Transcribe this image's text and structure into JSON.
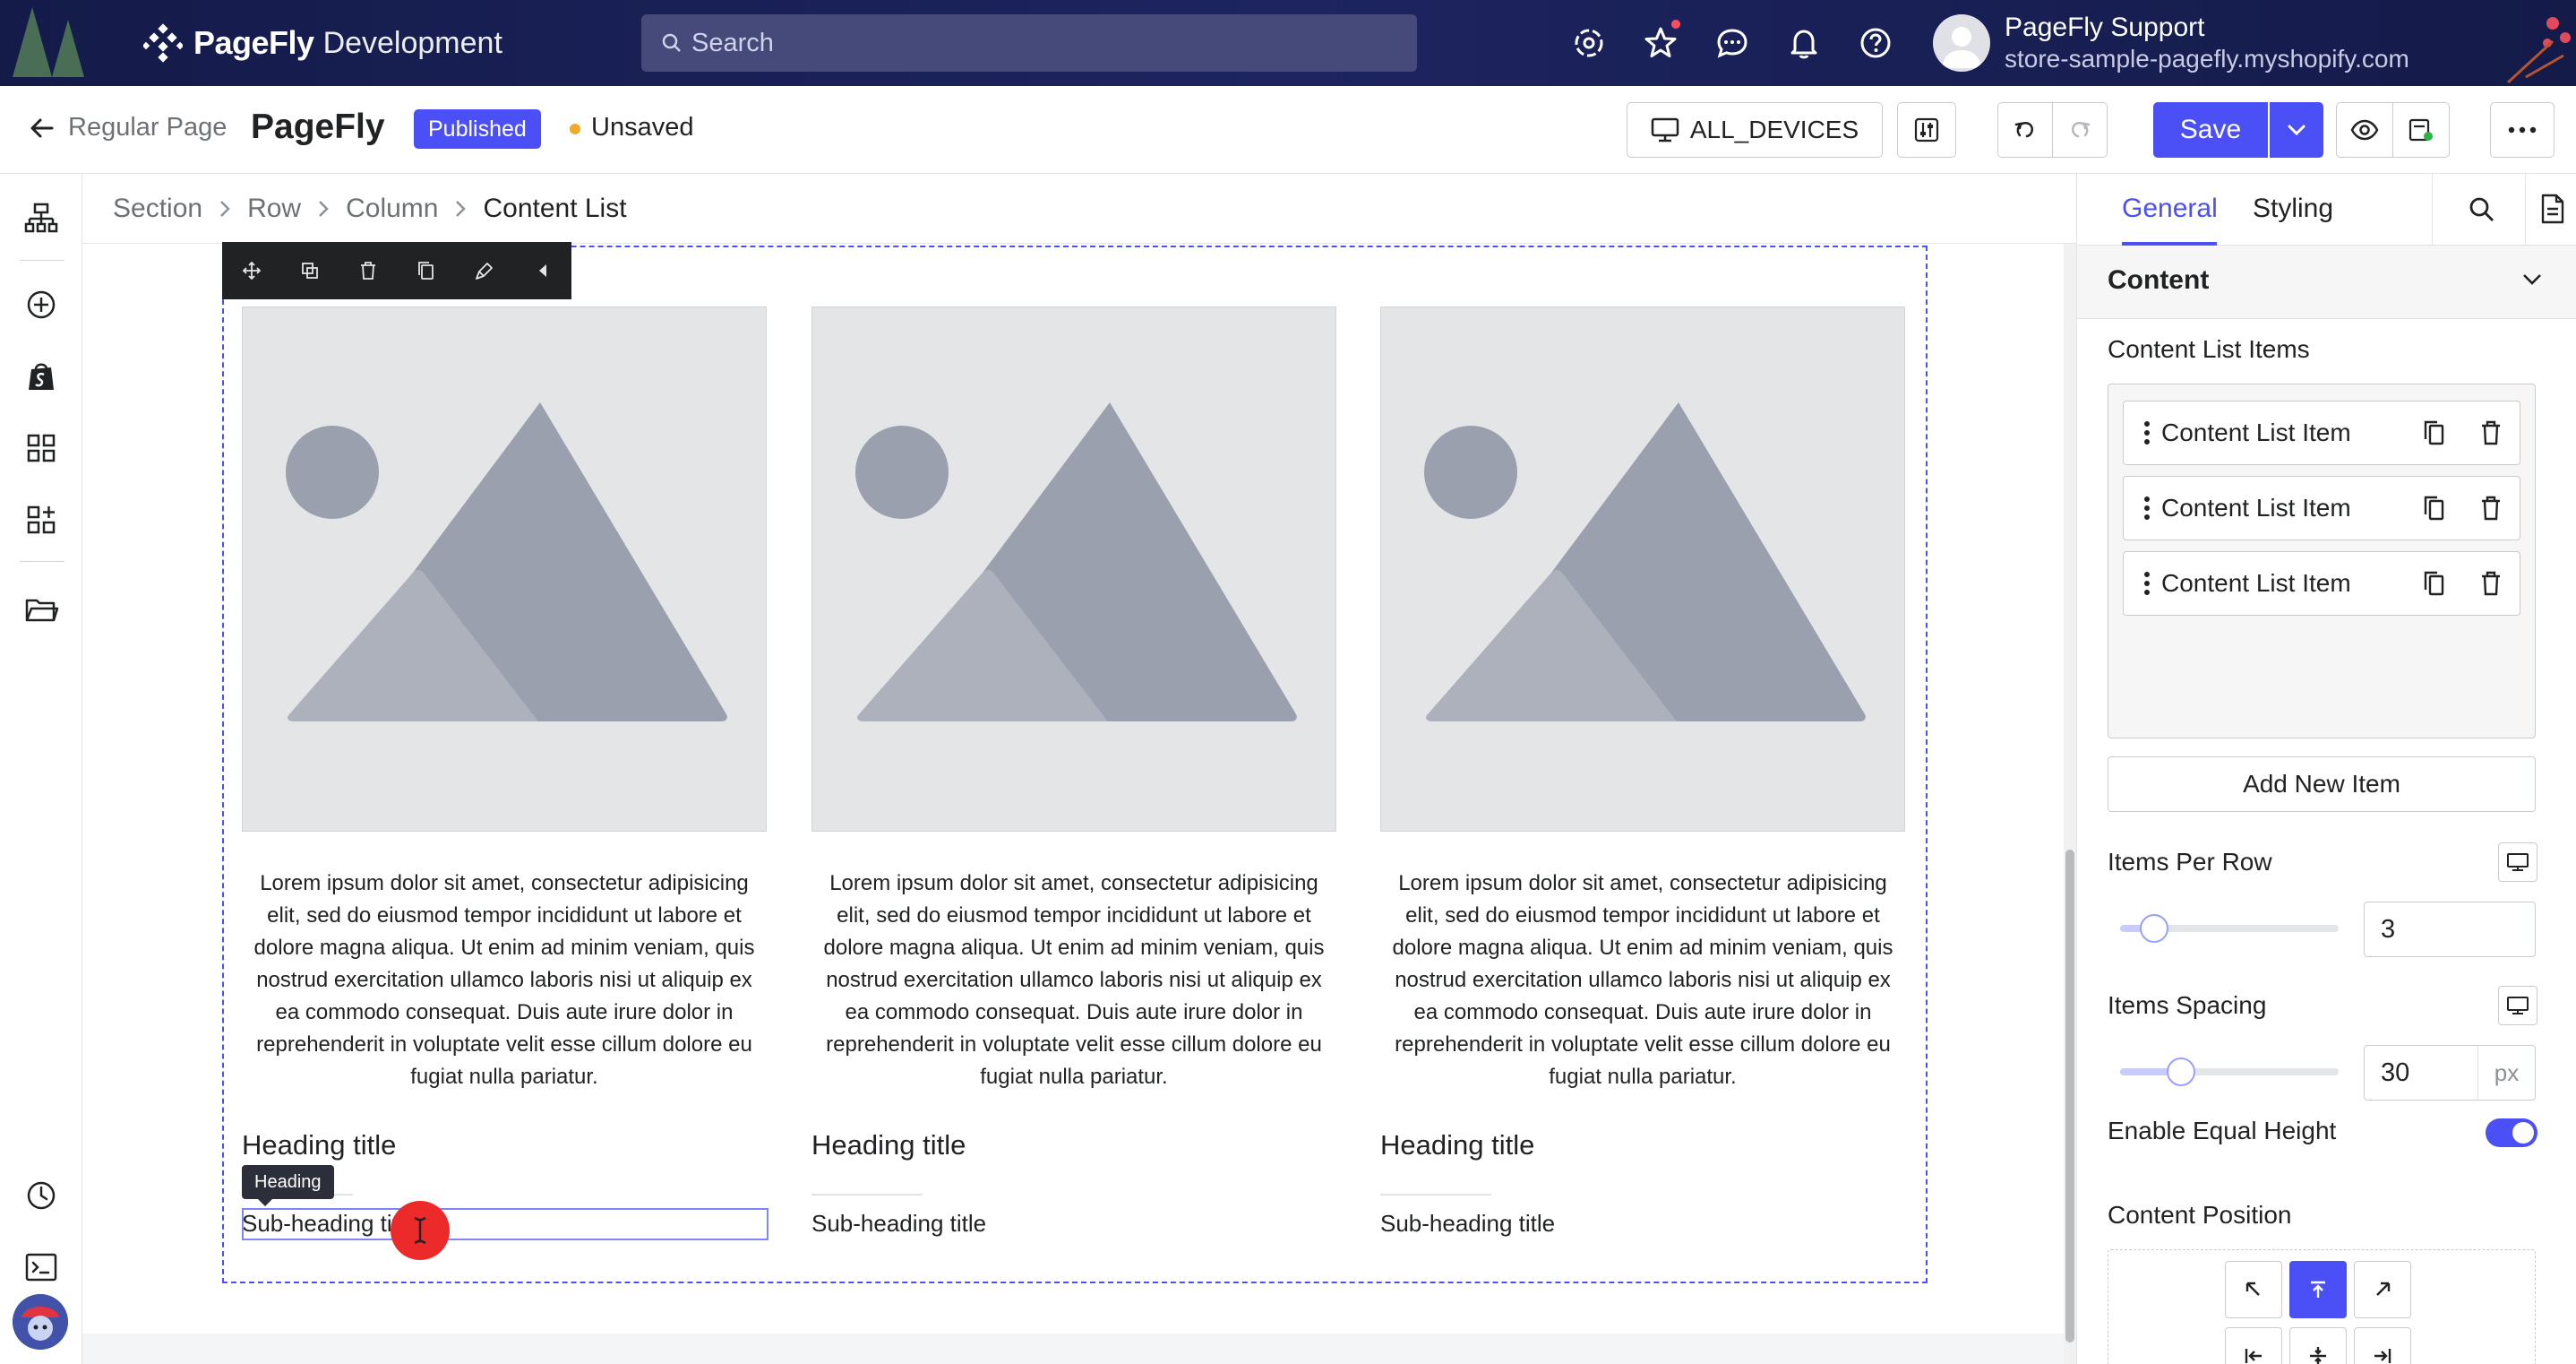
{
  "topbar": {
    "brand": "PageFly",
    "brand_suffix": "Development",
    "search_placeholder": "Search",
    "user_name": "PageFly Support",
    "user_store": "store-sample-pagefly.myshopify.com"
  },
  "header": {
    "page_type": "Regular Page",
    "page_name": "PageFly",
    "status_badge": "Published",
    "unsaved_label": "Unsaved",
    "devices_label": "ALL_DEVICES",
    "save_label": "Save"
  },
  "breadcrumb": [
    "Section",
    "Row",
    "Column",
    "Content List"
  ],
  "canvas": {
    "description": "Lorem ipsum dolor sit amet, consectetur adipisicing elit, sed do eiusmod tempor incididunt ut labore et dolore magna aliqua. Ut enim ad minim veniam, quis nostrud exercitation ullamco laboris nisi ut aliquip ex ea commodo consequat. Duis aute irure dolor in reprehenderit in voluptate velit esse cillum dolore eu fugiat nulla pariatur.",
    "cards": [
      {
        "heading": "Heading title",
        "subheading": "Sub-heading title"
      },
      {
        "heading": "Heading title",
        "subheading": "Sub-heading title"
      },
      {
        "heading": "Heading title",
        "subheading": "Sub-heading title"
      }
    ],
    "tooltip": "Heading"
  },
  "panel": {
    "tab_general": "General",
    "tab_styling": "Styling",
    "section_title": "Content",
    "items_label": "Content List Items",
    "items": [
      "Content List Item",
      "Content List Item",
      "Content List Item"
    ],
    "add_item_label": "Add New Item",
    "items_per_row_label": "Items Per Row",
    "items_per_row_value": "3",
    "items_spacing_label": "Items Spacing",
    "items_spacing_value": "30",
    "items_spacing_unit": "px",
    "equal_height_label": "Enable Equal Height",
    "equal_height_on": true,
    "content_position_label": "Content Position",
    "content_position_selected": "top-center"
  },
  "colors": {
    "accent": "#4b50f6",
    "topbar": "#1d2460",
    "cursor": "#ed2a2a"
  }
}
